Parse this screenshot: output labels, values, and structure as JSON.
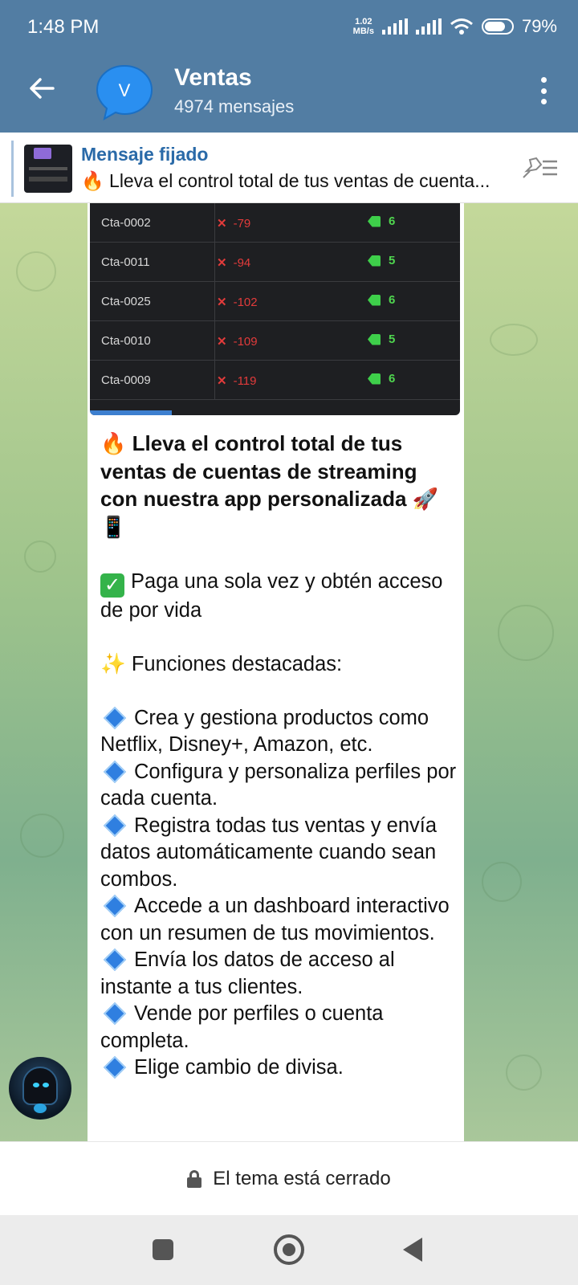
{
  "status": {
    "time": "1:48 PM",
    "net_speed_value": "1.02",
    "net_speed_unit": "MB/s",
    "battery": "79%"
  },
  "header": {
    "title": "Ventas",
    "subtitle": "4974 mensajes",
    "avatar_letter": "V",
    "avatar_color": "#2a8ff0"
  },
  "pinned": {
    "label": "Mensaje fijado",
    "text": "🔥 Lleva el control total de tus ventas de cuenta..."
  },
  "table_rows": [
    {
      "id": "Cta-0002",
      "neg": "-79",
      "pos": "6"
    },
    {
      "id": "Cta-0011",
      "neg": "-94",
      "pos": "5"
    },
    {
      "id": "Cta-0025",
      "neg": "-102",
      "pos": "6"
    },
    {
      "id": "Cta-0010",
      "neg": "-109",
      "pos": "5"
    },
    {
      "id": "Cta-0009",
      "neg": "-119",
      "pos": "6"
    }
  ],
  "message": {
    "headline_emoji": "🔥",
    "headline": "Lleva el control total de tus ventas de cuentas de streaming con nuestra app personalizada",
    "headline_end_emoji": "🚀📱",
    "check_line": "Paga una sola vez y obtén acceso de por vida",
    "features_emoji": "✨",
    "features_title": "Funciones destacadas:",
    "features": [
      "Crea y gestiona productos como Netflix, Disney+, Amazon, etc.",
      "Configura y personaliza perfiles por cada cuenta.",
      "Registra todas tus ventas y envía datos automáticamente cuando sean combos.",
      "Accede a un dashboard interactivo con un resumen de tus movimientos.",
      "Envía los datos de acceso al instante a tus clientes.",
      "Vende por perfiles o cuenta completa.",
      "Elige cambio de divisa."
    ]
  },
  "footer": {
    "closed_text": "El tema está cerrado"
  }
}
